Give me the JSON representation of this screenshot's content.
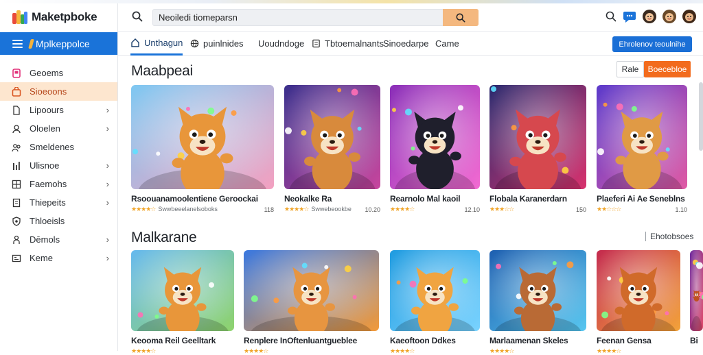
{
  "app": {
    "title": "Maketpboke"
  },
  "sidebar": {
    "header_label": "Mplkeppolce",
    "items": [
      {
        "label": "Geoems",
        "icon": "game-icon",
        "active": false,
        "chevron": false
      },
      {
        "label": "Sioeoons",
        "icon": "bag-icon",
        "active": true,
        "chevron": false
      },
      {
        "label": "Lipoours",
        "icon": "page-icon",
        "active": false,
        "chevron": true
      },
      {
        "label": "Oloelen",
        "icon": "user-icon",
        "active": false,
        "chevron": true
      },
      {
        "label": "Smeldenes",
        "icon": "people-icon",
        "active": false,
        "chevron": false
      },
      {
        "label": "Ulisnoe",
        "icon": "bars-icon",
        "active": false,
        "chevron": true
      },
      {
        "label": "Faemohs",
        "icon": "grid-icon",
        "active": false,
        "chevron": true
      },
      {
        "label": "Thiepeits",
        "icon": "doc-icon",
        "active": false,
        "chevron": true
      },
      {
        "label": "Thloeisls",
        "icon": "shield-icon",
        "active": false,
        "chevron": false
      },
      {
        "label": "Dēmols",
        "icon": "person-icon",
        "active": false,
        "chevron": true
      },
      {
        "label": "Keme",
        "icon": "box-icon",
        "active": false,
        "chevron": true
      }
    ]
  },
  "search": {
    "value": "Neoiledi tiomeparsn"
  },
  "tabs": [
    {
      "label": "Unthagun",
      "icon": "home-icon",
      "active": true
    },
    {
      "label": "puinlnides",
      "icon": "globe-icon",
      "active": false
    },
    {
      "label": "Uoudndoge",
      "icon": "",
      "active": false
    },
    {
      "label": "Tbtoemalnants",
      "icon": "list-icon",
      "active": false
    },
    {
      "label": "Sinoedarpe",
      "icon": "",
      "active": false
    },
    {
      "label": "Came",
      "icon": "",
      "active": false
    }
  ],
  "tabs_cta": "Ehrolenov teoulnihe",
  "section1": {
    "title": "Maabpeai",
    "btn_outline": "Rale",
    "btn_orange": "Boecebloe",
    "cards": [
      {
        "title": "Rsoouanamoolentiene Geroockai",
        "rating": 4,
        "sub": "Swwbeeelanelsoboks",
        "count": "118"
      },
      {
        "title": "Neokalke Ra",
        "rating": 4,
        "sub": "Swwebeookbe",
        "count": "10.20"
      },
      {
        "title": "Rearnolo Mal kaoil",
        "rating": 4,
        "sub": "",
        "count": "12.10"
      },
      {
        "title": "Flobala Karanerdarn",
        "rating": 3,
        "sub": "",
        "count": "150"
      },
      {
        "title": "Plaeferi Ai Ae Seneblns",
        "rating": 2,
        "sub": "",
        "count": "1.10"
      }
    ]
  },
  "section2": {
    "title": "Malkarane",
    "link": "Ehotobsoes",
    "cards": [
      {
        "title": "Keooma Reil Geelltark",
        "rating": 4
      },
      {
        "title": "Renplere InOftenluantgueblee",
        "rating": 4
      },
      {
        "title": "Kaeoftoon Ddkes",
        "rating": 4
      },
      {
        "title": "Marlaamenan Skeles",
        "rating": 4
      },
      {
        "title": "Feenan Gensa",
        "rating": 4
      },
      {
        "title": "Bi",
        "rating": 0
      }
    ]
  },
  "colors": {
    "accent_blue": "#1a73d9",
    "accent_orange": "#f26b1d",
    "active_nav_bg": "#fde6cf",
    "star": "#f0a427"
  },
  "card_art": [
    {
      "bg1": "#7ec8f2",
      "bg2": "#f4a0c0",
      "char": "#e8963a"
    },
    {
      "bg1": "#3a2f8c",
      "bg2": "#c8469e",
      "char": "#d88a3c"
    },
    {
      "bg1": "#8a2fb8",
      "bg2": "#f36bd2",
      "char": "#1f1f2c"
    },
    {
      "bg1": "#2a2a6e",
      "bg2": "#d8326e",
      "char": "#d6484e"
    },
    {
      "bg1": "#5b3acb",
      "bg2": "#e05aa4",
      "char": "#e09a45"
    },
    {
      "bg1": "#66b9ee",
      "bg2": "#8fd36c",
      "char": "#e8963a"
    },
    {
      "bg1": "#3a78e0",
      "bg2": "#f29a3a",
      "char": "#e79540"
    },
    {
      "bg1": "#1f9be0",
      "bg2": "#7ad3ff",
      "char": "#f0a441"
    },
    {
      "bg1": "#1e5fb0",
      "bg2": "#58c7f0",
      "char": "#b96a35"
    },
    {
      "bg1": "#c42a4e",
      "bg2": "#f3a33a",
      "char": "#d06a2a"
    },
    {
      "bg1": "#6e2a9e",
      "bg2": "#e04a6a",
      "char": "#c05020"
    }
  ]
}
